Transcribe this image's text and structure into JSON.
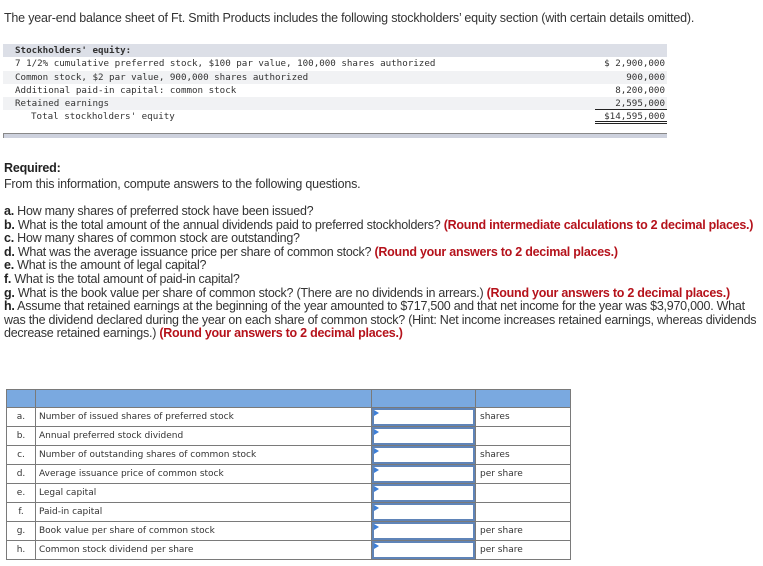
{
  "intro": "The year-end balance sheet of Ft. Smith Products includes the following stockholders’ equity section (with certain details omitted).",
  "statement": {
    "header": "Stockholders' equity:",
    "rows": [
      {
        "label": "7 1/2% cumulative preferred stock, $100 par value, 100,000 shares authorized",
        "amount": "$ 2,900,000"
      },
      {
        "label": "Common stock, $2 par value, 900,000 shares authorized",
        "amount": "900,000"
      },
      {
        "label": "Additional paid-in capital: common stock",
        "amount": "8,200,000"
      },
      {
        "label": "Retained earnings",
        "amount": "2,595,000"
      }
    ],
    "total": {
      "label": "Total stockholders' equity",
      "amount": "$14,595,000"
    }
  },
  "required": {
    "title": "Required:",
    "text": "From this information, compute answers to the following questions."
  },
  "questions": [
    {
      "letter": "a.",
      "text": " How many shares of preferred stock have been issued?",
      "hint": ""
    },
    {
      "letter": "b.",
      "text": " What is the total amount of the annual dividends paid to preferred stockholders? ",
      "hint": "(Round intermediate calculations to 2 decimal places.)"
    },
    {
      "letter": "c.",
      "text": " How many shares of common stock are outstanding?",
      "hint": ""
    },
    {
      "letter": "d.",
      "text": " What was the average issuance price per share of common stock? ",
      "hint": "(Round your answers to 2 decimal places.)"
    },
    {
      "letter": "e.",
      "text": " What is the amount of legal capital?",
      "hint": ""
    },
    {
      "letter": "f.",
      "text": " What is the total amount of paid-in capital?",
      "hint": ""
    },
    {
      "letter": "g.",
      "text": " What is the book value per share of common stock? (There are no dividends in arrears.) ",
      "hint": "(Round your answers to 2 decimal places.)"
    },
    {
      "letter": "h.",
      "text": " Assume that retained earnings at the beginning of the year amounted to $717,500 and that net income for the year was $3,970,000. What was the dividend declared during the year on each share of common stock? (Hint: Net income increases retained earnings, whereas dividends decrease retained earnings.) ",
      "hint": "(Round your answers to 2 decimal places.)"
    }
  ],
  "answer_table": {
    "header_color": "#7aa9e0",
    "rows": [
      {
        "letter": "a.",
        "label": "Number of issued shares of preferred stock",
        "value": "",
        "unit": "shares"
      },
      {
        "letter": "b.",
        "label": "Annual preferred stock dividend",
        "value": "",
        "unit": ""
      },
      {
        "letter": "c.",
        "label": "Number of outstanding shares of common stock",
        "value": "",
        "unit": "shares"
      },
      {
        "letter": "d.",
        "label": "Average issuance price of common stock",
        "value": "",
        "unit": "per share"
      },
      {
        "letter": "e.",
        "label": "Legal capital",
        "value": "",
        "unit": ""
      },
      {
        "letter": "f.",
        "label": "Paid-in capital",
        "value": "",
        "unit": ""
      },
      {
        "letter": "g.",
        "label": "Book value per share of common stock",
        "value": "",
        "unit": "per share"
      },
      {
        "letter": "h.",
        "label": "Common stock dividend per share",
        "value": "",
        "unit": "per share"
      }
    ]
  }
}
